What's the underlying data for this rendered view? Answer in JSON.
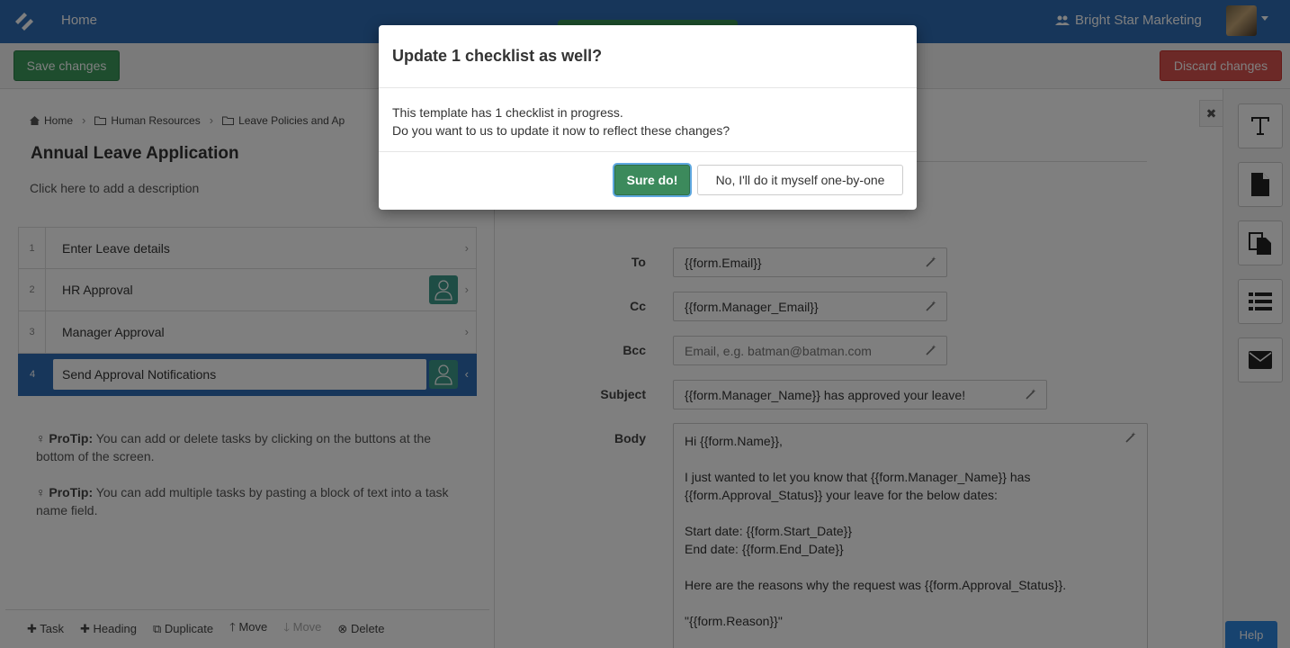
{
  "nav": {
    "home": "Home",
    "org_name": "Bright Star Marketing"
  },
  "toolbar": {
    "save": "Save changes",
    "discard": "Discard changes"
  },
  "breadcrumb": [
    "Home",
    "Human Resources",
    "Leave Policies and Ap"
  ],
  "page": {
    "title": "Annual Leave Application",
    "description": "Click here to add a description"
  },
  "tasks": [
    {
      "num": "1",
      "name": "Enter Leave details"
    },
    {
      "num": "2",
      "name": "HR Approval"
    },
    {
      "num": "3",
      "name": "Manager Approval"
    },
    {
      "num": "4",
      "name": "Send Approval Notifications"
    }
  ],
  "protips": [
    {
      "label": "ProTip:",
      "text": " You can add or delete tasks by clicking on the buttons at the bottom of the screen."
    },
    {
      "label": "ProTip:",
      "text": " You can add multiple tasks by pasting a block of text into a task name field."
    }
  ],
  "bottom_actions": {
    "task": "Task",
    "heading": "Heading",
    "duplicate": "Duplicate",
    "move_up": "Move",
    "move_down": "Move",
    "delete": "Delete"
  },
  "email": {
    "to_label": "To",
    "to_value": "{{form.Email}}",
    "cc_label": "Cc",
    "cc_value": "{{form.Manager_Email}}",
    "bcc_label": "Bcc",
    "bcc_placeholder": "Email, e.g. batman@batman.com",
    "subject_label": "Subject",
    "subject_value": "{{form.Manager_Name}} has approved your leave!",
    "body_label": "Body",
    "body_value": "Hi {{form.Name}},\n\nI just wanted to let you know that {{form.Manager_Name}} has\n{{form.Approval_Status}} your leave for the below dates:\n\nStart date: {{form.Start_Date}}\nEnd date: {{form.End_Date}}\n\nHere are the reasons why the request was {{form.Approval_Status}}.\n\n\"{{form.Reason}}\""
  },
  "help": "Help",
  "modal": {
    "title": "Update 1 checklist as well?",
    "line1": "This template has 1 checklist in progress.",
    "line2": "Do you want to us to update it now to reflect these changes?",
    "confirm": "Sure do!",
    "decline": "No, I'll do it myself one-by-one"
  },
  "colors": {
    "nav": "#2e6db4",
    "save": "#3c9a5c",
    "discard": "#d9534f",
    "active_task": "#2e6db4",
    "assignee": "#3c9a8a"
  }
}
